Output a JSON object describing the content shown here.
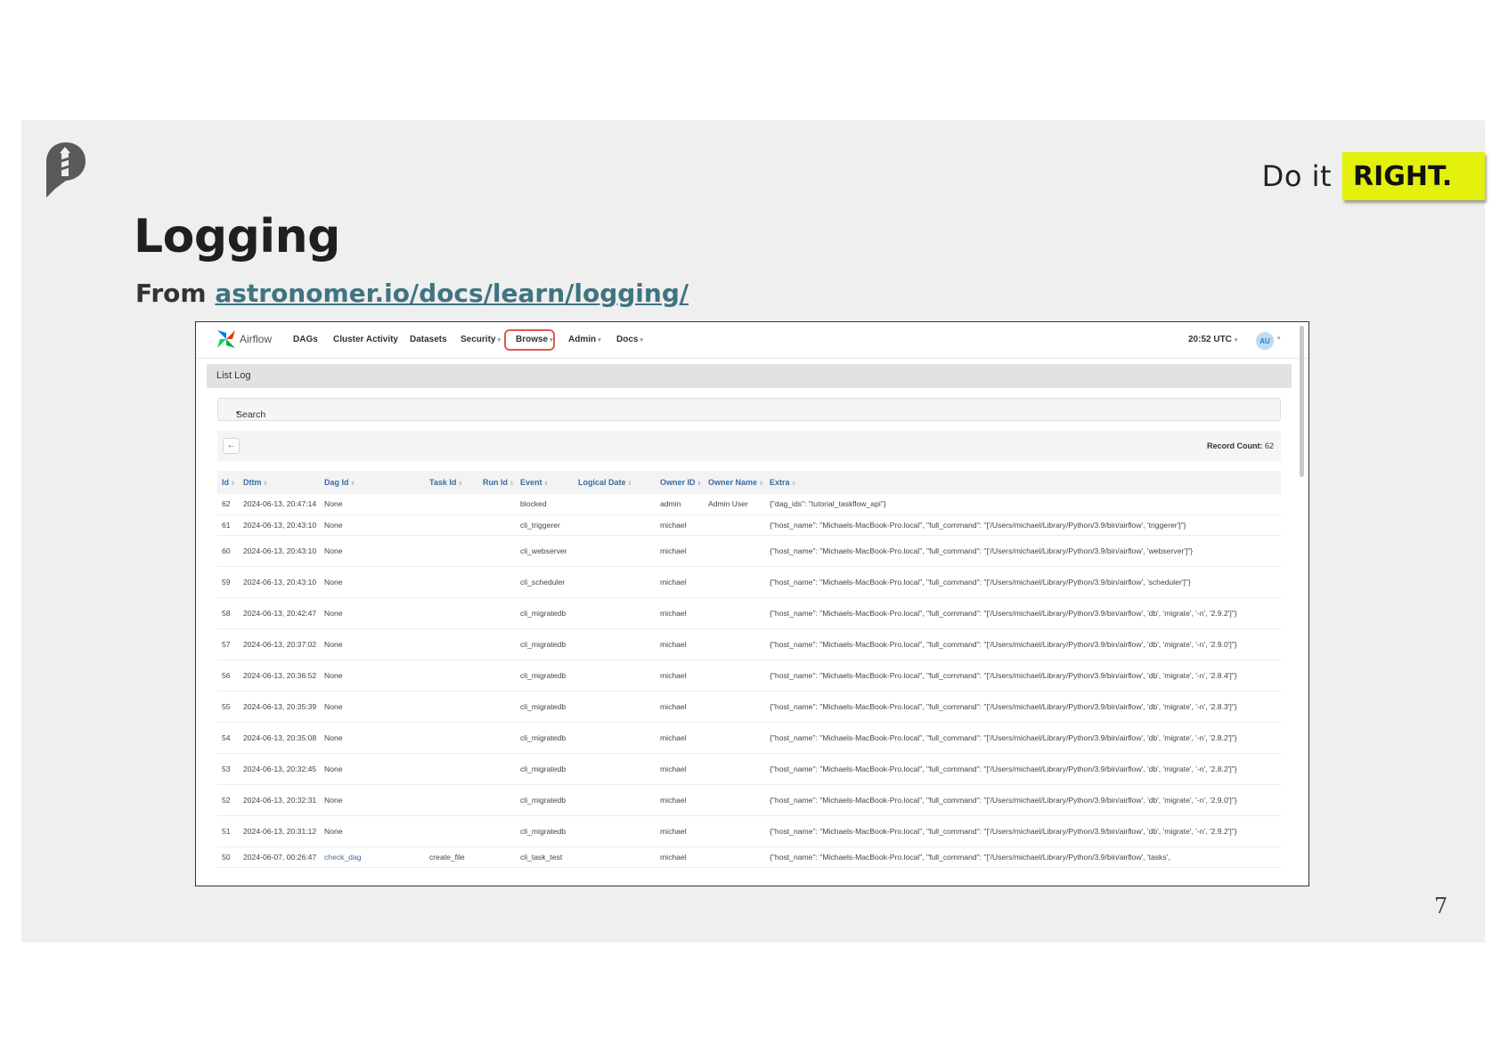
{
  "slide": {
    "tagline_do": "Do it",
    "tagline_right": "RIGHT.",
    "title": "Logging",
    "subtitle_prefix": "From",
    "subtitle_link": "astronomer.io/docs/learn/logging/",
    "page_number": "7"
  },
  "airflow": {
    "brand": "Airflow",
    "nav": [
      "DAGs",
      "Cluster Activity",
      "Datasets",
      "Security",
      "Browse",
      "Admin",
      "Docs"
    ],
    "time": "20:52 UTC",
    "avatar": "AU",
    "panel_title": "List Log",
    "search_label": "Search",
    "back_icon": "arrow-left-icon",
    "record_count_label": "Record Count:",
    "record_count_value": "62",
    "columns": [
      "Id",
      "Dttm",
      "Dag Id",
      "Task Id",
      "Run Id",
      "Event",
      "Logical Date",
      "Owner ID",
      "Owner Name",
      "Extra"
    ],
    "rows": [
      {
        "id": "62",
        "dttm": "2024-06-13, 20:47:14",
        "dag": "None",
        "task": "",
        "run": "",
        "event": "blocked",
        "logical": "",
        "owner": "admin",
        "owner_name": "Admin User",
        "extra": "{\"dag_ids\": \"tutorial_taskflow_api\"}"
      },
      {
        "id": "61",
        "dttm": "2024-06-13, 20:43:10",
        "dag": "None",
        "task": "",
        "run": "",
        "event": "cli_triggerer",
        "logical": "",
        "owner": "michael",
        "owner_name": "",
        "extra": "{\"host_name\": \"Michaels-MacBook-Pro.local\", \"full_command\": \"['/Users/michael/Library/Python/3.9/bin/airflow', 'triggerer']\"}"
      },
      {
        "id": "60",
        "dttm": "2024-06-13, 20:43:10",
        "dag": "None",
        "task": "",
        "run": "",
        "event": "cli_webserver",
        "logical": "",
        "owner": "michael",
        "owner_name": "",
        "extra": "{\"host_name\": \"Michaels-MacBook-Pro.local\", \"full_command\": \"['/Users/michael/Library/Python/3.9/bin/airflow', 'webserver']\"}"
      },
      {
        "id": "59",
        "dttm": "2024-06-13, 20:43:10",
        "dag": "None",
        "task": "",
        "run": "",
        "event": "cli_scheduler",
        "logical": "",
        "owner": "michael",
        "owner_name": "",
        "extra": "{\"host_name\": \"Michaels-MacBook-Pro.local\", \"full_command\": \"['/Users/michael/Library/Python/3.9/bin/airflow', 'scheduler']\"}"
      },
      {
        "id": "58",
        "dttm": "2024-06-13, 20:42:47",
        "dag": "None",
        "task": "",
        "run": "",
        "event": "cli_migratedb",
        "logical": "",
        "owner": "michael",
        "owner_name": "",
        "extra": "{\"host_name\": \"Michaels-MacBook-Pro.local\", \"full_command\": \"['/Users/michael/Library/Python/3.9/bin/airflow', 'db', 'migrate', '-n', '2.9.2']\"}"
      },
      {
        "id": "57",
        "dttm": "2024-06-13, 20:37:02",
        "dag": "None",
        "task": "",
        "run": "",
        "event": "cli_migratedb",
        "logical": "",
        "owner": "michael",
        "owner_name": "",
        "extra": "{\"host_name\": \"Michaels-MacBook-Pro.local\", \"full_command\": \"['/Users/michael/Library/Python/3.9/bin/airflow', 'db', 'migrate', '-n', '2.9.0']\"}"
      },
      {
        "id": "56",
        "dttm": "2024-06-13, 20:36:52",
        "dag": "None",
        "task": "",
        "run": "",
        "event": "cli_migratedb",
        "logical": "",
        "owner": "michael",
        "owner_name": "",
        "extra": "{\"host_name\": \"Michaels-MacBook-Pro.local\", \"full_command\": \"['/Users/michael/Library/Python/3.9/bin/airflow', 'db', 'migrate', '-n', '2.8.4']\"}"
      },
      {
        "id": "55",
        "dttm": "2024-06-13, 20:35:39",
        "dag": "None",
        "task": "",
        "run": "",
        "event": "cli_migratedb",
        "logical": "",
        "owner": "michael",
        "owner_name": "",
        "extra": "{\"host_name\": \"Michaels-MacBook-Pro.local\", \"full_command\": \"['/Users/michael/Library/Python/3.9/bin/airflow', 'db', 'migrate', '-n', '2.8.3']\"}"
      },
      {
        "id": "54",
        "dttm": "2024-06-13, 20:35:08",
        "dag": "None",
        "task": "",
        "run": "",
        "event": "cli_migratedb",
        "logical": "",
        "owner": "michael",
        "owner_name": "",
        "extra": "{\"host_name\": \"Michaels-MacBook-Pro.local\", \"full_command\": \"['/Users/michael/Library/Python/3.9/bin/airflow', 'db', 'migrate', '-n', '2.8.2']\"}"
      },
      {
        "id": "53",
        "dttm": "2024-06-13, 20:32:45",
        "dag": "None",
        "task": "",
        "run": "",
        "event": "cli_migratedb",
        "logical": "",
        "owner": "michael",
        "owner_name": "",
        "extra": "{\"host_name\": \"Michaels-MacBook-Pro.local\", \"full_command\": \"['/Users/michael/Library/Python/3.9/bin/airflow', 'db', 'migrate', '-n', '2.8.2']\"}"
      },
      {
        "id": "52",
        "dttm": "2024-06-13, 20:32:31",
        "dag": "None",
        "task": "",
        "run": "",
        "event": "cli_migratedb",
        "logical": "",
        "owner": "michael",
        "owner_name": "",
        "extra": "{\"host_name\": \"Michaels-MacBook-Pro.local\", \"full_command\": \"['/Users/michael/Library/Python/3.9/bin/airflow', 'db', 'migrate', '-n', '2.9.0']\"}"
      },
      {
        "id": "51",
        "dttm": "2024-06-13, 20:31:12",
        "dag": "None",
        "task": "",
        "run": "",
        "event": "cli_migratedb",
        "logical": "",
        "owner": "michael",
        "owner_name": "",
        "extra": "{\"host_name\": \"Michaels-MacBook-Pro.local\", \"full_command\": \"['/Users/michael/Library/Python/3.9/bin/airflow', 'db', 'migrate', '-n', '2.9.2']\"}"
      },
      {
        "id": "50",
        "dttm": "2024-06-07, 00:26:47",
        "dag": "check_dag",
        "task": "create_file",
        "run": "",
        "event": "cli_task_test",
        "logical": "",
        "owner": "michael",
        "owner_name": "",
        "extra": "{\"host_name\": \"Michaels-MacBook-Pro.local\", \"full_command\": \"['/Users/michael/Library/Python/3.9/bin/airflow', 'tasks',"
      }
    ]
  },
  "colors": {
    "accent": "#e3f00b",
    "link": "#3f7482",
    "highlight": "#e0584e"
  }
}
